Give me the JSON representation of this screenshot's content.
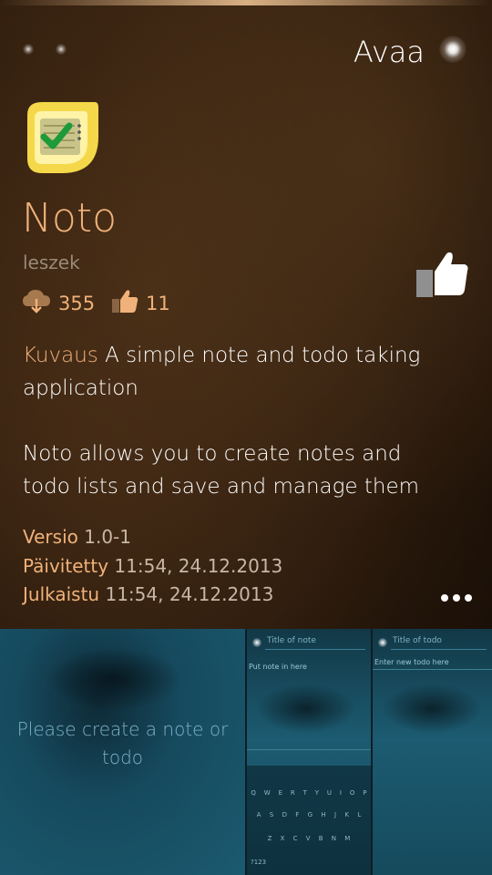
{
  "header": {
    "open_label": "Avaa"
  },
  "app": {
    "name": "Noto",
    "author": "leszek",
    "downloads": "355",
    "likes": "11",
    "icon": "noto-app-icon"
  },
  "description": {
    "label": "Kuvaus",
    "text": "A simple note and todo taking application",
    "text2": "Noto allows you to create notes and todo lists and save and manage them"
  },
  "meta": {
    "version_label": "Versio",
    "version_value": "1.0-1",
    "updated_label": "Päivitetty",
    "updated_value": "11:54, 24.12.2013",
    "published_label": "Julkaistu",
    "published_value": "11:54, 24.12.2013"
  },
  "screenshots": {
    "shot1_message": "Please create a note or todo",
    "shot2_field": "Title of note",
    "shot2_placeholder": "Put note in here",
    "shot3_field": "Title of todo",
    "shot3_placeholder": "Enter new todo here",
    "kb_row1": [
      "Q",
      "W",
      "E",
      "R",
      "T",
      "Y",
      "U",
      "I",
      "O",
      "P"
    ],
    "kb_row2": [
      "A",
      "S",
      "D",
      "F",
      "G",
      "H",
      "J",
      "K",
      "L"
    ],
    "kb_row3": [
      "Z",
      "X",
      "C",
      "V",
      "B",
      "N",
      "M"
    ],
    "kb_mode": "?123"
  },
  "colors": {
    "accent": "#f0b27a",
    "secondary": "#9a8a7a",
    "screenshot_text": "#7fb2c6"
  }
}
